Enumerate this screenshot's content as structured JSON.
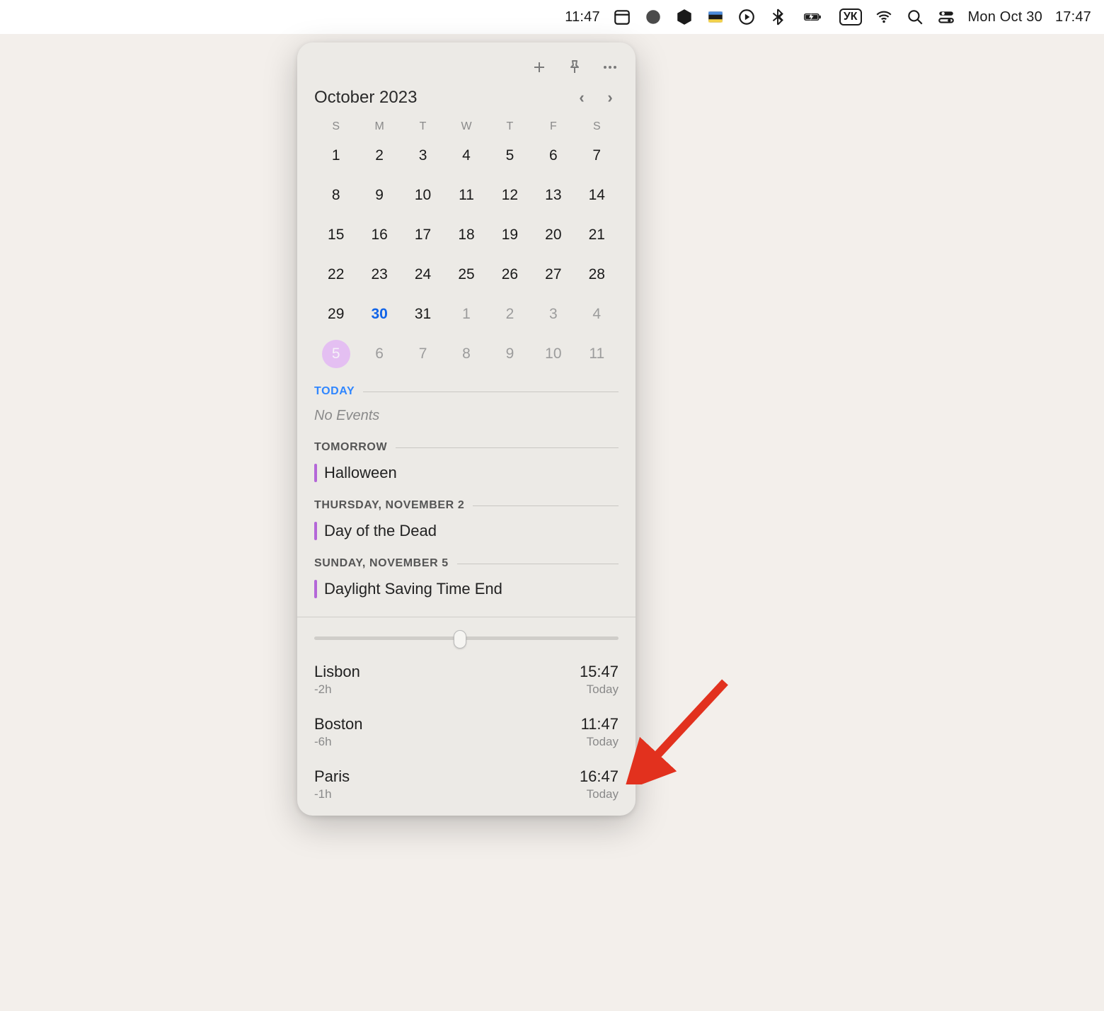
{
  "menubar": {
    "widget_time": "11:47",
    "date_text": "Mon Oct 30",
    "system_time": "17:47",
    "keyboard_indicator": "УК"
  },
  "toolbar": {
    "add_label": "Add",
    "pin_label": "Pin",
    "more_label": "More"
  },
  "calendar": {
    "title": "October 2023",
    "weekdays": [
      "S",
      "M",
      "T",
      "W",
      "T",
      "F",
      "S"
    ],
    "weeks": [
      [
        {
          "d": "1"
        },
        {
          "d": "2"
        },
        {
          "d": "3"
        },
        {
          "d": "4"
        },
        {
          "d": "5"
        },
        {
          "d": "6"
        },
        {
          "d": "7"
        }
      ],
      [
        {
          "d": "8"
        },
        {
          "d": "9"
        },
        {
          "d": "10"
        },
        {
          "d": "11"
        },
        {
          "d": "12"
        },
        {
          "d": "13"
        },
        {
          "d": "14"
        }
      ],
      [
        {
          "d": "15"
        },
        {
          "d": "16"
        },
        {
          "d": "17"
        },
        {
          "d": "18"
        },
        {
          "d": "19"
        },
        {
          "d": "20"
        },
        {
          "d": "21"
        }
      ],
      [
        {
          "d": "22"
        },
        {
          "d": "23"
        },
        {
          "d": "24"
        },
        {
          "d": "25"
        },
        {
          "d": "26"
        },
        {
          "d": "27"
        },
        {
          "d": "28"
        }
      ],
      [
        {
          "d": "29"
        },
        {
          "d": "30",
          "today": true
        },
        {
          "d": "31"
        },
        {
          "d": "1",
          "out": true
        },
        {
          "d": "2",
          "out": true
        },
        {
          "d": "3",
          "out": true
        },
        {
          "d": "4",
          "out": true
        }
      ],
      [
        {
          "d": "5",
          "out": true,
          "selected": true
        },
        {
          "d": "6",
          "out": true
        },
        {
          "d": "7",
          "out": true
        },
        {
          "d": "8",
          "out": true
        },
        {
          "d": "9",
          "out": true
        },
        {
          "d": "10",
          "out": true
        },
        {
          "d": "11",
          "out": true
        }
      ]
    ]
  },
  "sections": [
    {
      "label": "TODAY",
      "today": true,
      "no_events": "No Events",
      "events": []
    },
    {
      "label": "TOMORROW",
      "events": [
        {
          "title": "Halloween",
          "color": "#b467d8"
        }
      ]
    },
    {
      "label": "THURSDAY, NOVEMBER 2",
      "events": [
        {
          "title": "Day of the Dead",
          "color": "#b467d8"
        }
      ]
    },
    {
      "label": "SUNDAY, NOVEMBER 5",
      "events": [
        {
          "title": "Daylight Saving Time End",
          "color": "#b467d8"
        }
      ]
    }
  ],
  "slider": {
    "position_percent": 48
  },
  "timezones": [
    {
      "city": "Lisbon",
      "offset": "-2h",
      "time": "15:47",
      "day": "Today"
    },
    {
      "city": "Boston",
      "offset": "-6h",
      "time": "11:47",
      "day": "Today"
    },
    {
      "city": "Paris",
      "offset": "-1h",
      "time": "16:47",
      "day": "Today"
    }
  ]
}
